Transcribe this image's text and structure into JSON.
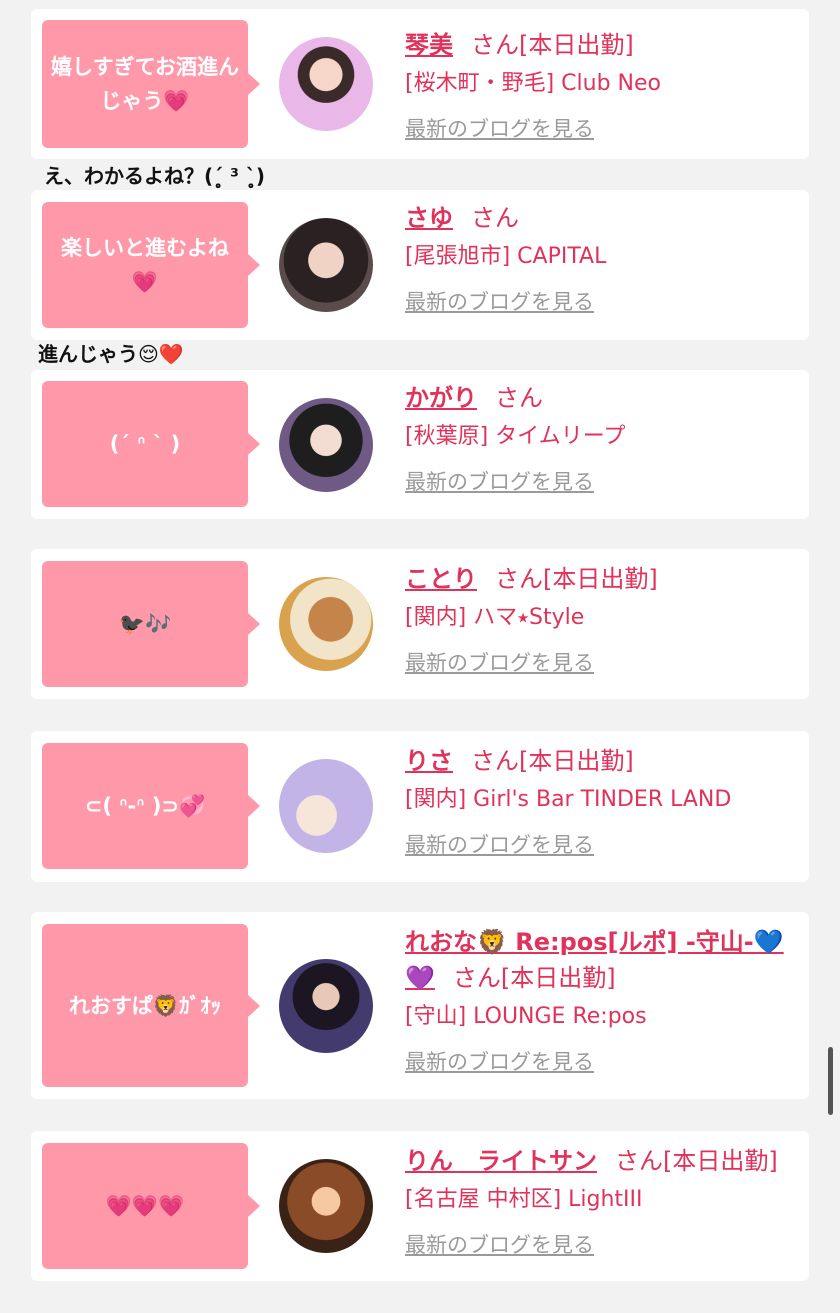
{
  "entries": [
    {
      "message": "嬉しすぎてお酒進んじゃう💗",
      "name": "琴美",
      "suffix": "さん[本日出勤]",
      "shop": "[桜木町・野毛] Club Neo",
      "blog_link": "最新のブログを見る"
    },
    {
      "message": "楽しいと進むよね💗",
      "name": "さゆ",
      "suffix": "さん",
      "shop": "[尾張旭市] CAPITAL",
      "blog_link": "最新のブログを見る"
    },
    {
      "message": "(ˊ ᐢ ˋ )",
      "name": "かがり",
      "suffix": "さん",
      "shop": "[秋葉原] タイムリープ",
      "blog_link": "最新のブログを見る"
    },
    {
      "message": "🐦‍⬛🎶",
      "name": "ことり",
      "suffix": "さん[本日出勤]",
      "shop": "[関内] ハマ⭑Style",
      "blog_link": "最新のブログを見る"
    },
    {
      "message": "⊂( ᐢ-ᐢ )⊃💞",
      "name": "りさ",
      "suffix": "さん[本日出勤]",
      "shop": "[関内] Girl's Bar TINDER LAND",
      "blog_link": "最新のブログを見る"
    },
    {
      "message": "れおすぱ🦁ｶﾞｵｯ",
      "name": "れおな🦁 Re:pos[ルポ] -守山-💙💜",
      "suffix": "さん[本日出勤]",
      "shop": "[守山] LOUNGE Re:pos",
      "blog_link": "最新のブログを見る"
    },
    {
      "message": "💗💗💗",
      "name": "りん　ライトサン",
      "suffix": "さん[本日出勤]",
      "shop": "[名古屋 中村区] LightIII",
      "blog_link": "最新のブログを見る"
    }
  ],
  "captions": [
    "え、わかるよね？(ˊ̥̥̥̥̥ ³ ˋ̥̥̥̥̥)",
    "進んじゃう😌❤️"
  ],
  "colors": {
    "accent": "#e0325a",
    "bubble": "#ff99aa",
    "link_gray": "#9a9a9a",
    "background": "#f2f2f2"
  },
  "icons": [
    "scrollbar"
  ]
}
